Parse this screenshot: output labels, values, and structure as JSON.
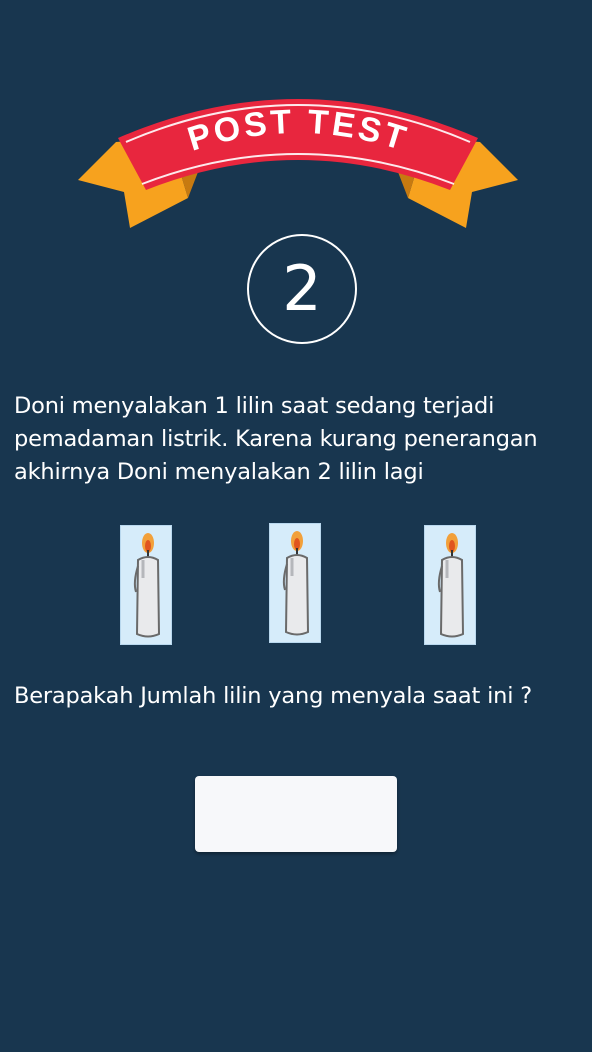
{
  "header": {
    "banner_title": "POST TEST",
    "banner_colors": {
      "ribbon": "#e8263e",
      "tails": "#f7a21e",
      "text": "#ffffff"
    }
  },
  "question": {
    "number": "2",
    "text": "Doni menyalakan 1 lilin saat sedang terjadi pemadaman listrik. Karena kurang penerangan akhirnya Doni menyalakan 2 lilin lagi",
    "prompt": "Berapakah Jumlah lilin yang menyala saat ini ?",
    "images": [
      "candle-icon",
      "candle-icon",
      "candle-icon"
    ]
  },
  "answer": {
    "value": "",
    "placeholder": ""
  },
  "theme": {
    "background": "#18364f",
    "card": "#d6ecfa"
  }
}
